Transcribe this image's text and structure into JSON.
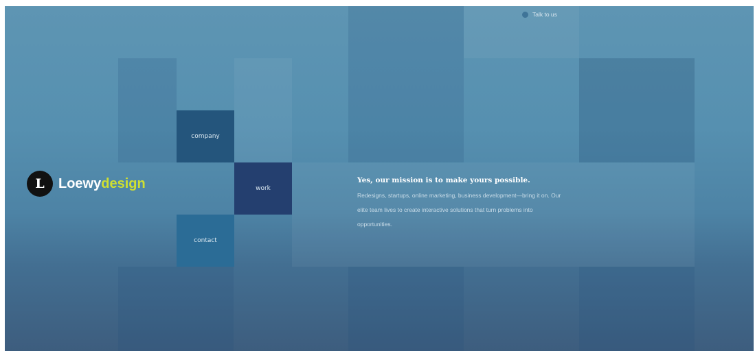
{
  "header": {
    "talk_label": "Talk to us"
  },
  "logo": {
    "mark": "L",
    "word_primary": "Loewy",
    "word_accent": "design"
  },
  "nav": {
    "company": "company",
    "work": "work",
    "contact": "contact"
  },
  "mission": {
    "heading": "Yes, our mission is to make yours possible.",
    "body": "Redesigns, startups, online marketing, business development—bring it on. Our elite team lives to create interactive solutions that turn problems into opportunities."
  },
  "colors": {
    "background": "#5690b0",
    "nav_company": "#24557c",
    "nav_work": "#243f6f",
    "nav_contact": "#2b6c96",
    "logo_accent": "#cfe031"
  },
  "icons": {
    "talk": "chat-bubble-icon"
  }
}
